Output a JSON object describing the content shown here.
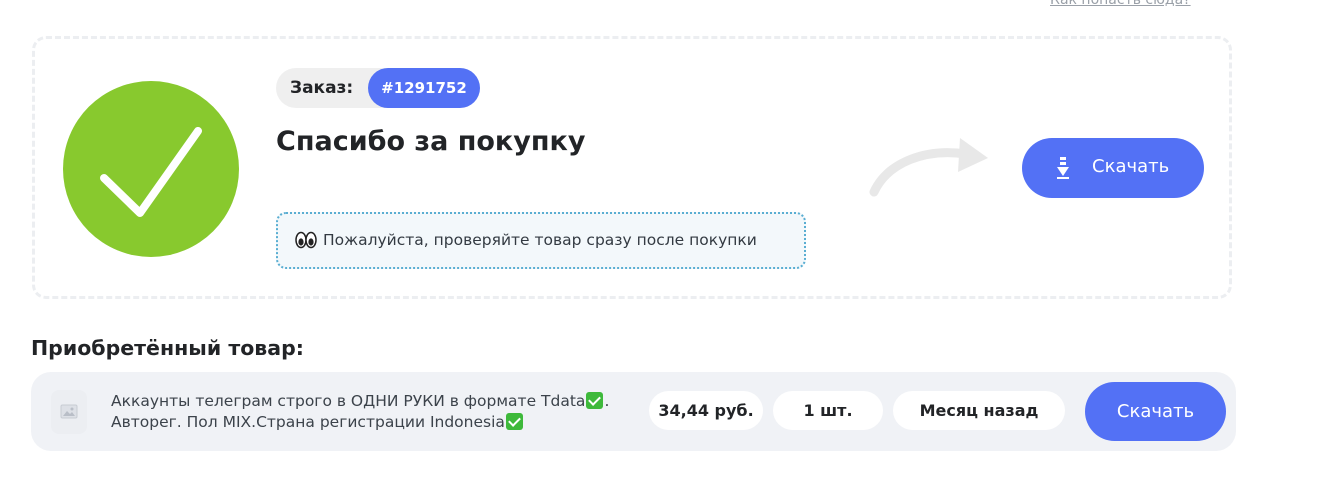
{
  "top_link": "Как попасть сюда?",
  "order": {
    "label": "Заказ:",
    "number": "#1291752"
  },
  "title": "Спасибо за покупку",
  "notice": {
    "icon": "eyes-emoji",
    "text": "Пожалуйста, проверяйте товар сразу после покупки"
  },
  "download_main": {
    "icon": "download-arrow-icon",
    "label": "Скачать"
  },
  "purchased": {
    "title": "Приобретённый товар:",
    "product": {
      "name_line1": "Аккаунты телеграм строго в ОДНИ РУКИ в формате Tdata",
      "name_line1_suffix": ".",
      "name_line2": "Авторег. Пол MIX.Страна регистрации Indonesia",
      "price": "34,44 руб.",
      "quantity": "1 шт.",
      "date": "Месяц назад",
      "download_label": "Скачать"
    }
  },
  "colors": {
    "accent": "#5371f5",
    "success": "#88c92e",
    "notice_border": "#5aaed2",
    "row_bg": "#f0f2f6"
  }
}
